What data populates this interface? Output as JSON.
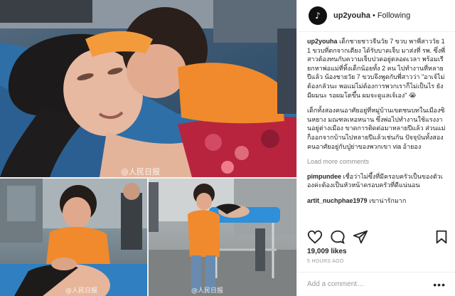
{
  "post": {
    "username": "up2youha",
    "follow_state": "Following",
    "avatar_glyph": "♪"
  },
  "photo": {
    "watermark_top": "@人民日报",
    "watermark_bottom_left": "@人民日报",
    "watermark_bottom_right": "@人民日报"
  },
  "caption": {
    "username": "up2youha",
    "paragraph1": "เด็กชายชาวจีนวัย 7 ขวบ พาพี่สาววัย 11 ขวบที่ตกจากเตียง ได้รับบาดเจ็บ มาส่งที่ รพ. ซึ่งพี่สาวต้องทนกับความเจ็บปวดอยู่ตลอดเวลา พร้อมเรียกหาพ่อแม่ที่ทิ้งเด็กน้อยทั้ง 2 คน ไปทำงานที่หลายปีแล้ว น้องชายวัย 7 ขวบจึงพูดกับพี่สาวว่า \"อาเจ้ไม่ต้องกลัวนะ พอแม่ไม่ต้องการพวกเราก็ไม่เป็นไร ยังมีผมนะ รอผมโตขึ้น ผมจะดูแลเจ้เอง\" 😭",
    "paragraph2": "เด็กทั้งสองคนอาศัยอยู่ที่หมู่บ้านเขตชนบทในเมืองซินหยาง มณฑลเหอหนาน ซึ่งพ่อไปทำงานใช้แรงงานอยู่ต่างเมือง ขาดการติดต่อมาหลายปีแล้ว ส่วนแม่ก็ออกจากบ้านไปหลายปีแล้วเช่นกัน ปัจจุบันทั้งสองคนอาศัยอยู่กับปู่ย่าของพวกเขา via อ้ายอง"
  },
  "load_more": "Load more comments",
  "comments": [
    {
      "username": "pimpundee",
      "text": "เชื่อว่าไม่ซึ้งที่มีครอบครัวเป็นของตัวเองค่ะต้องเป็นหัวหน้าครอบครัวที่ดีแน่นอน"
    },
    {
      "username": "artit_nuchphae1979",
      "text": "เขาน่ารักมาก"
    }
  ],
  "actions": {
    "like_icon": "heart-outline-icon",
    "comment_icon": "speech-bubble-icon",
    "share_icon": "paper-plane-icon",
    "save_icon": "bookmark-icon"
  },
  "likes_text": "19,009 likes",
  "timestamp": "5 HOURS AGO",
  "add_comment": {
    "placeholder": "Add a comment…",
    "more_glyph": "•••"
  }
}
